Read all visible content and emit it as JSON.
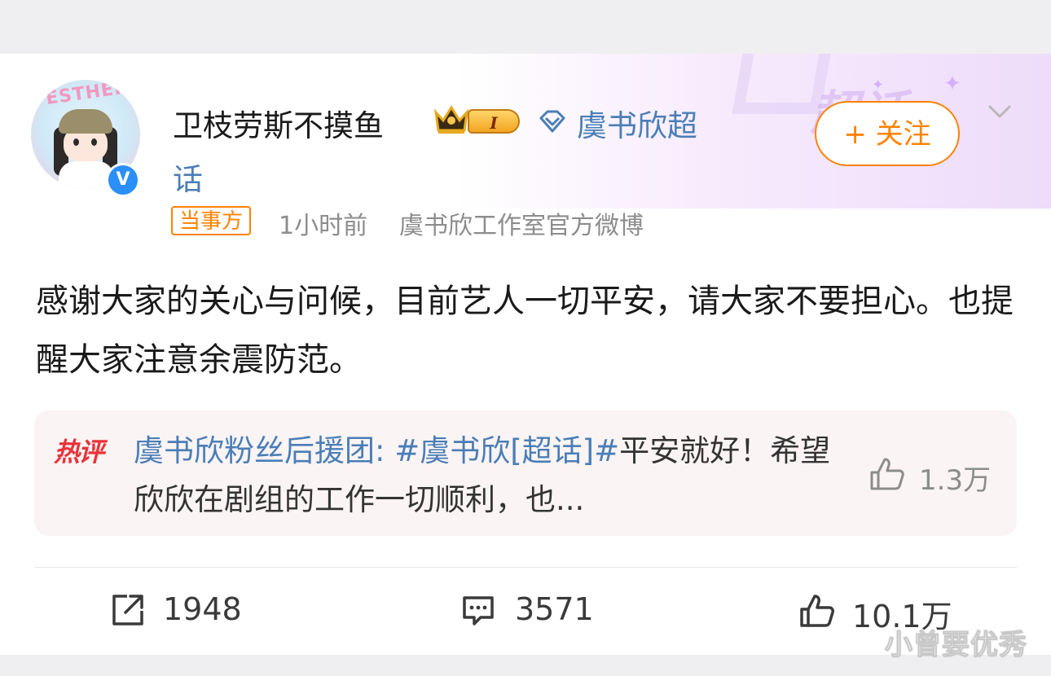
{
  "post": {
    "username": "卫枝劳斯不摸鱼",
    "level_badge": "I",
    "supertopic_line1": "虞书欣超",
    "supertopic_line2": "话",
    "follow_label": "+ 关注",
    "party_tag": "当事方",
    "time": "1小时前",
    "source": "虞书欣工作室官方微博",
    "text": "感谢大家的关心与问候，目前艺人一切平安，请大家不要担心。也提醒大家注意余震防范。",
    "banner_text": "超话"
  },
  "avatar": {
    "word": "ESTHER",
    "verified": "V"
  },
  "hot_comment": {
    "label": "热评",
    "author": "虞书欣粉丝后援团",
    "separator": ": ",
    "tag": "#虞书欣[超话]#",
    "body": "平安就好！希望欣欣在剧组的工作一切顺利，也...",
    "likes": "1.3万"
  },
  "actions": {
    "reposts": "1948",
    "comments": "3571",
    "likes": "10.1万"
  },
  "watermark": "小曾要优秀",
  "colors": {
    "accent_orange": "#ff8200",
    "link_blue": "#4a7eb7",
    "hot_red": "#e8343a",
    "verified_blue": "#2a8ff7"
  },
  "icons": [
    "crown-icon",
    "diamond-icon",
    "chevron-down-icon",
    "thumbs-up-icon",
    "repost-icon",
    "comment-icon"
  ]
}
